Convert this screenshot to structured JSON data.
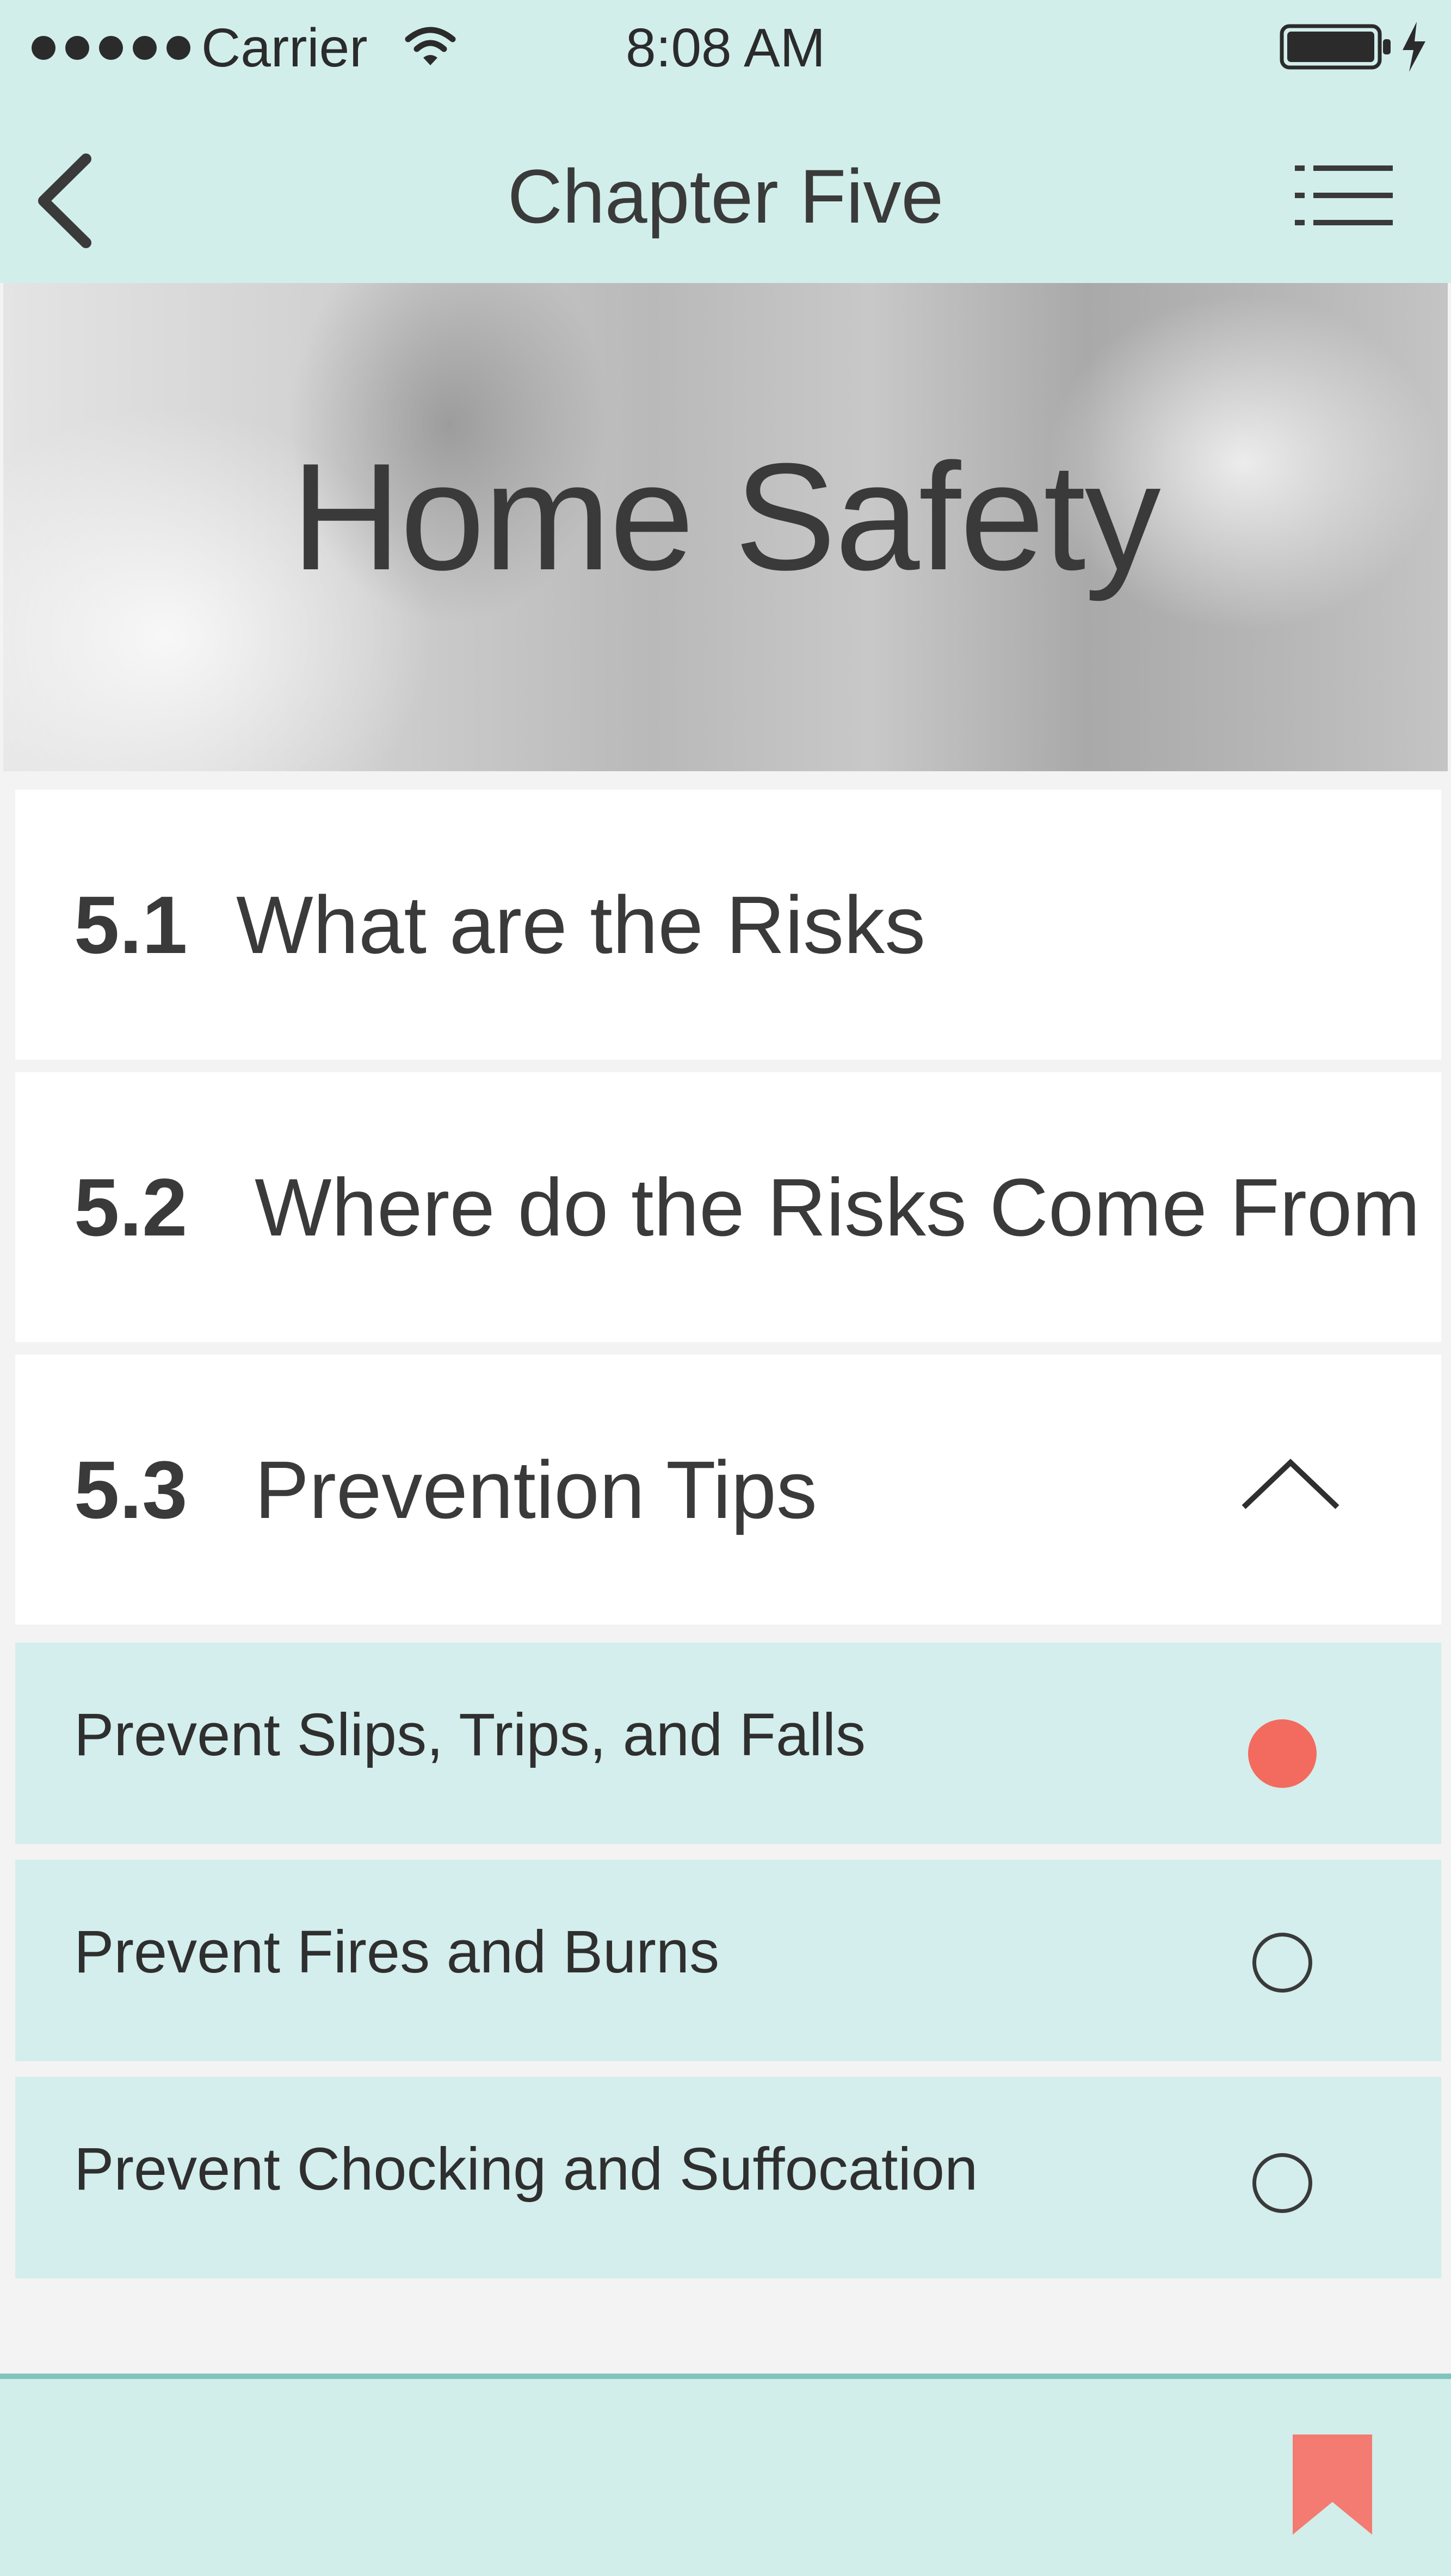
{
  "status_bar": {
    "carrier": "Carrier",
    "time": "8:08 AM"
  },
  "nav": {
    "title": "Chapter Five",
    "back_icon": "chevron-left-icon",
    "menu_icon": "list-icon"
  },
  "hero": {
    "title": "Home Safety"
  },
  "sections": [
    {
      "number": "5.1",
      "title": "What are the Risks"
    },
    {
      "number": "5.2",
      "title": "Where do the Risks Come From"
    },
    {
      "number": "5.3",
      "title": "Prevention Tips",
      "expanded": true
    }
  ],
  "subsections": [
    {
      "label": "Prevent Slips, Trips, and Falls",
      "active": true
    },
    {
      "label": "Prevent Fires and Burns",
      "active": false
    },
    {
      "label": "Prevent Chocking and Suffocation",
      "active": false
    }
  ],
  "colors": {
    "header_bg": "#d1eeeb",
    "subsection_bg": "#d3eeec",
    "accent": "#f36b5f",
    "bookmark": "#f47b72",
    "divider": "#7fc5bd"
  },
  "bottom_bar": {
    "bookmark_icon": "bookmark-icon"
  }
}
